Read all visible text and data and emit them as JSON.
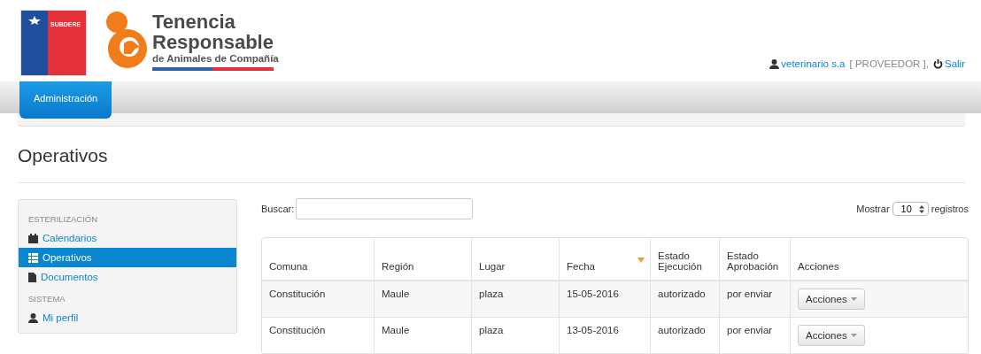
{
  "header": {
    "agency_logo": {
      "label": "SUBDERE"
    },
    "brand": {
      "line_1": "Tenencia",
      "line_2": "Responsable",
      "subtitle": "de Animales de Compañía"
    },
    "user": {
      "name": "veterinario s.a",
      "role": "[ PROVEEDOR ],",
      "logout": "Salir"
    }
  },
  "nav_tabs": [
    {
      "label": "Administración",
      "selected": true
    }
  ],
  "page_title": "Operativos",
  "sidebar": {
    "sections": [
      {
        "heading": "ESTERILIZACIÓN",
        "items": [
          {
            "label": "Calendarios",
            "kind": "calendar",
            "selected": false
          },
          {
            "label": "Operativos",
            "kind": "list",
            "selected": true
          },
          {
            "label": "Documentos",
            "kind": "file",
            "selected": false
          }
        ]
      },
      {
        "heading": "SISTEMA",
        "items": [
          {
            "label": "Mi perfil",
            "kind": "user",
            "selected": false
          }
        ]
      }
    ]
  },
  "search": {
    "label": "Buscar:"
  },
  "page_length": {
    "label_before": "Mostrar",
    "value": "10",
    "label_after": "registros"
  },
  "table": {
    "columns": [
      {
        "label": "Comuna",
        "sorted": false
      },
      {
        "label": "Región",
        "sorted": false
      },
      {
        "label": "Lugar",
        "sorted": false
      },
      {
        "label": "Fecha",
        "sorted": true
      },
      {
        "label": "Estado Ejecución",
        "sorted": false
      },
      {
        "label": "Estado Aprobación",
        "sorted": false
      },
      {
        "label": "Acciones",
        "sorted": false
      }
    ],
    "rows": [
      {
        "cells": [
          "Constitución",
          "Maule",
          "plaza",
          "15-05-2016",
          "autorizado",
          "por enviar"
        ],
        "action": "Acciones"
      },
      {
        "cells": [
          "Constitución",
          "Maule",
          "plaza",
          "13-05-2016",
          "autorizado",
          "por enviar"
        ],
        "action": "Acciones"
      }
    ]
  }
}
